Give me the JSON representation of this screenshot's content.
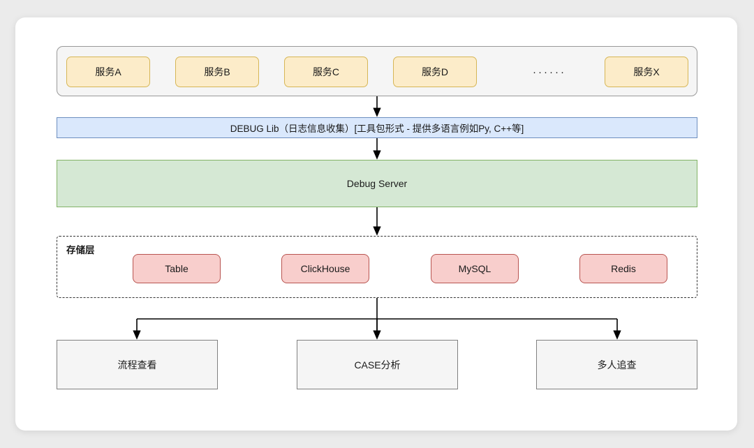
{
  "diagram": {
    "services_row": {
      "items": [
        {
          "label": "服务A"
        },
        {
          "label": "服务B"
        },
        {
          "label": "服务C"
        },
        {
          "label": "服务D"
        },
        {
          "label": "服务X"
        }
      ],
      "ellipsis": "······"
    },
    "debug_lib": {
      "label": "DEBUG Lib（日志信息收集）[工具包形式 - 提供多语言例如Py, C++等]"
    },
    "debug_server": {
      "label": "Debug Server"
    },
    "storage_layer": {
      "title": "存储层",
      "stores": [
        {
          "label": "Table"
        },
        {
          "label": "ClickHouse"
        },
        {
          "label": "MySQL"
        },
        {
          "label": "Redis"
        }
      ]
    },
    "consumers": [
      {
        "label": "流程查看"
      },
      {
        "label": "CASE分析"
      },
      {
        "label": "多人追查"
      }
    ]
  },
  "colors": {
    "service_fill": "#fcecc9",
    "service_stroke": "#d6b656",
    "debug_lib_fill": "#dae8fc",
    "debug_lib_stroke": "#6c8ebf",
    "debug_server_fill": "#d5e8d4",
    "debug_server_stroke": "#82b366",
    "store_fill": "#f8cecc",
    "store_stroke": "#b85450",
    "consumer_fill": "#f5f5f5",
    "consumer_stroke": "#808080",
    "connector": "#000000",
    "page_background": "#ebebeb",
    "card_background": "#ffffff"
  }
}
